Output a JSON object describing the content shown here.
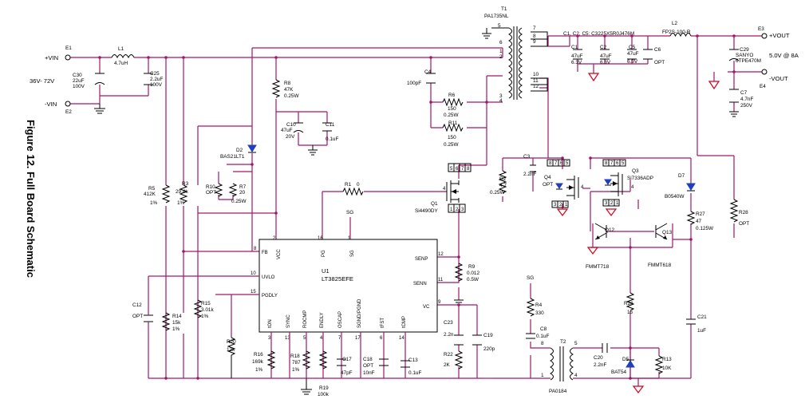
{
  "title": "Figure 12. Full Board Schematic",
  "terminals": {
    "vin_pos": {
      "ref": "E1",
      "label": "+VIN"
    },
    "vin_neg": {
      "ref": "E2",
      "label": "-VIN"
    },
    "vin_range": "36V- 72V",
    "vout_pos": {
      "ref": "E3",
      "label": "+VOUT"
    },
    "vout_neg": {
      "ref": "E4",
      "label": "-VOUT"
    },
    "vout_spec": "5.0V @ 8A"
  },
  "inductors": {
    "L1": {
      "ref": "L1",
      "value": "4.7uH"
    },
    "L2": {
      "ref": "L2",
      "value": "FP2S-100-R"
    }
  },
  "transformers": {
    "T1": {
      "ref": "T1",
      "part": "PA1735NL",
      "pins": [
        "5",
        "6",
        "1",
        "2",
        "3",
        "4",
        "7",
        "8",
        "9",
        "10",
        "11",
        "12"
      ]
    },
    "T2": {
      "ref": "T2",
      "part": "PA0184",
      "pins": [
        "8",
        "5",
        "1",
        "4"
      ]
    }
  },
  "capacitors": {
    "C30": {
      "ref": "C30",
      "v1": "22uF",
      "v2": "100V"
    },
    "C25": {
      "ref": "C25",
      "v1": "2.2uF",
      "v2": "100V"
    },
    "C4": {
      "ref": "C4",
      "v1": "100pF"
    },
    "C10": {
      "ref": "C10",
      "v1": "47uF",
      "v2": "20V"
    },
    "C11": {
      "ref": "C11",
      "v1": "0.1uF"
    },
    "C1": {
      "ref": "C1",
      "v1": "47uF",
      "v2": "6.3V"
    },
    "C2": {
      "ref": "C2",
      "v1": "47uF",
      "v2": "6.3V"
    },
    "C5": {
      "ref": "C5",
      "v1": "47uF",
      "v2": "6.3V"
    },
    "C6": {
      "ref": "C6",
      "v1": "OPT"
    },
    "C29": {
      "ref": "C29",
      "v1": "SANYO",
      "v2": "6TPE470M"
    },
    "C7": {
      "ref": "C7",
      "v1": "4.7nF",
      "v2": "250V"
    },
    "C3": {
      "ref": "C3",
      "v1": "2.2nF"
    },
    "C12": {
      "ref": "C12",
      "v1": "OPT"
    },
    "C17": {
      "ref": "C17",
      "v1": "47pF"
    },
    "C18": {
      "ref": "C18",
      "v1": "OPT",
      "v2": "10nF"
    },
    "C13": {
      "ref": "C13",
      "v1": "0.1uF"
    },
    "C23": {
      "ref": "C23",
      "v1": "2.2n"
    },
    "C19": {
      "ref": "C19",
      "v1": "220p"
    },
    "C8": {
      "ref": "C8",
      "v1": "0.1uF"
    },
    "C20": {
      "ref": "C20",
      "v1": "2.2nF"
    },
    "C21": {
      "ref": "C21",
      "v1": "1uF"
    },
    "cap_note": "C1, C2, C5: C3225X5R0J476M"
  },
  "resistors": {
    "R8": {
      "ref": "R8",
      "v1": "47K",
      "v2": "0.25W"
    },
    "R5": {
      "ref": "R5",
      "v1": "412K",
      "v2": "1%"
    },
    "R3": {
      "ref": "R3",
      "v1": "29.4k",
      "v2": "1%"
    },
    "R10": {
      "ref": "R10",
      "v1": "OPT"
    },
    "R7": {
      "ref": "R7",
      "v1": "20",
      "v2": "0.25W"
    },
    "R6": {
      "ref": "R6",
      "v1": "150",
      "v2": "0.25W"
    },
    "R11": {
      "ref": "R11",
      "v1": "150",
      "v2": "0.25W"
    },
    "R1": {
      "ref": "R1",
      "v1": "0"
    },
    "R2": {
      "ref": "R2",
      "v1": "4.7",
      "v2": "0.25W"
    },
    "R9": {
      "ref": "R9",
      "v1": "0.012",
      "v2": "0.5W"
    },
    "R14": {
      "ref": "R14",
      "v1": "15k",
      "v2": "1%"
    },
    "R15": {
      "ref": "R15",
      "v1": "3.01k",
      "v2": "1%"
    },
    "R20": {
      "ref": "R20",
      "v1": "12k"
    },
    "R16": {
      "ref": "R16",
      "v1": "169k",
      "v2": "1%"
    },
    "R18": {
      "ref": "R18",
      "v1": "787",
      "v2": "1%"
    },
    "R19": {
      "ref": "R19",
      "v1": "100k"
    },
    "R22": {
      "ref": "R22",
      "v1": "2K"
    },
    "R4": {
      "ref": "R4",
      "v1": "330"
    },
    "R27": {
      "ref": "R27",
      "v1": "47",
      "v2": "0.125W"
    },
    "R28": {
      "ref": "R28",
      "v1": "OPT"
    },
    "R26": {
      "ref": "R26",
      "v1": "15"
    },
    "R13": {
      "ref": "R13",
      "v1": "10K"
    }
  },
  "diodes": {
    "D2": {
      "ref": "D2",
      "part": "BAS21LT1"
    },
    "D7": {
      "ref": "D7",
      "part": "B0540W"
    },
    "D5": {
      "ref": "D5",
      "part": "BAT54"
    }
  },
  "transistors": {
    "Q1": {
      "ref": "Q1",
      "part": "Si4490DY",
      "pins": [
        "5",
        "6",
        "7",
        "8",
        "4",
        "1",
        "2",
        "3"
      ]
    },
    "Q4": {
      "ref": "Q4",
      "part": "OPT",
      "pins": [
        "8",
        "7",
        "6",
        "5",
        "4",
        "3",
        "2",
        "1"
      ]
    },
    "Q3": {
      "ref": "Q3",
      "part": "Si7336ADP",
      "pins": [
        "8",
        "7",
        "6",
        "5",
        "4",
        "3",
        "2",
        "1"
      ]
    },
    "Q12": {
      "ref": "Q12",
      "part": "FMMT718"
    },
    "Q13": {
      "ref": "Q13",
      "part": "FMMT618"
    }
  },
  "ic": {
    "ref": "U1",
    "part": "LT3825EFE",
    "left_pins": [
      {
        "num": "8",
        "name": "FB"
      },
      {
        "num": "10",
        "name": "UVLO"
      },
      {
        "num": "15",
        "name": "PGDLY"
      }
    ],
    "top_pins": [
      {
        "num": "2",
        "name": "VCC"
      },
      {
        "num": "16",
        "name": "PG"
      },
      {
        "num": "1",
        "name": "SG"
      }
    ],
    "right_pins": [
      {
        "num": "12",
        "name": "SENP"
      },
      {
        "num": "11",
        "name": "SENN"
      },
      {
        "num": "9",
        "name": "VC"
      }
    ],
    "bottom_pins": [
      {
        "num": "3",
        "name": "tON"
      },
      {
        "num": "13",
        "name": "SYNC"
      },
      {
        "num": "5",
        "name": "ROCMP"
      },
      {
        "num": "4",
        "name": "ENDLY"
      },
      {
        "num": "7",
        "name": "OSCAP"
      },
      {
        "num": "17",
        "name": "SGND/PGND"
      },
      {
        "num": "6",
        "name": "tFST"
      },
      {
        "num": "14",
        "name": "tCMP"
      }
    ]
  },
  "net_labels": {
    "sg1": "SG",
    "sg2": "SG",
    "opt_c6": "OPT"
  }
}
